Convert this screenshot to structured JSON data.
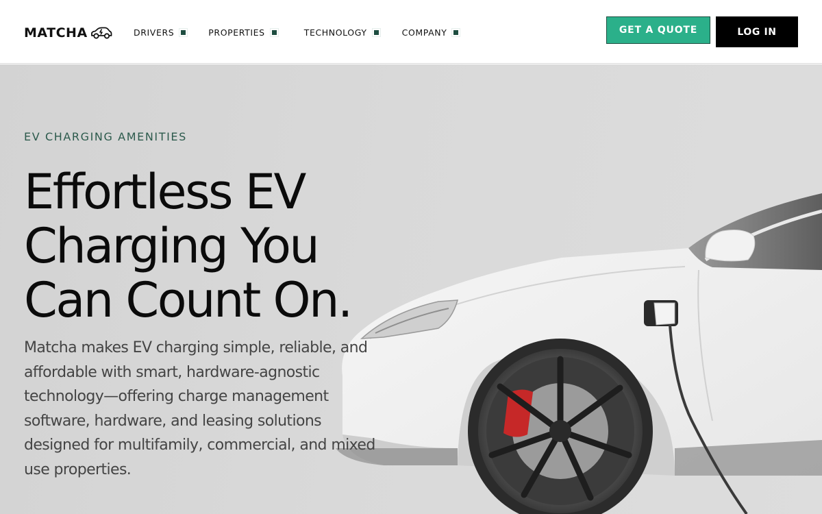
{
  "header": {
    "logo_text": "MATCHA",
    "logo_icon": "car-icon",
    "nav": [
      {
        "label": "DRIVERS",
        "icon": "dropdown-square-icon"
      },
      {
        "label": "PROPERTIES",
        "icon": "dropdown-square-icon"
      },
      {
        "label": "TECHNOLOGY",
        "icon": "dropdown-square-icon"
      },
      {
        "label": "COMPANY",
        "icon": "dropdown-square-icon"
      }
    ],
    "quote_button": "GET A QUOTE",
    "login_button": "LOG IN"
  },
  "hero": {
    "eyebrow": "EV CHARGING AMENITIES",
    "headline_lines": [
      "Effortless EV",
      "Charging You",
      "Can Count On."
    ],
    "description": "Matcha makes EV charging simple, reliable, and affordable with smart, hardware-agnostic technology—offering charge management software, hardware, and leasing solutions designed for multifamily, commercial, and mixed use properties.",
    "image": "white-electric-car-charging"
  },
  "colors": {
    "accent_green": "#2bb08a",
    "dark_green": "#1e4d40",
    "black": "#000000",
    "hero_background": "#d9d9d9"
  }
}
